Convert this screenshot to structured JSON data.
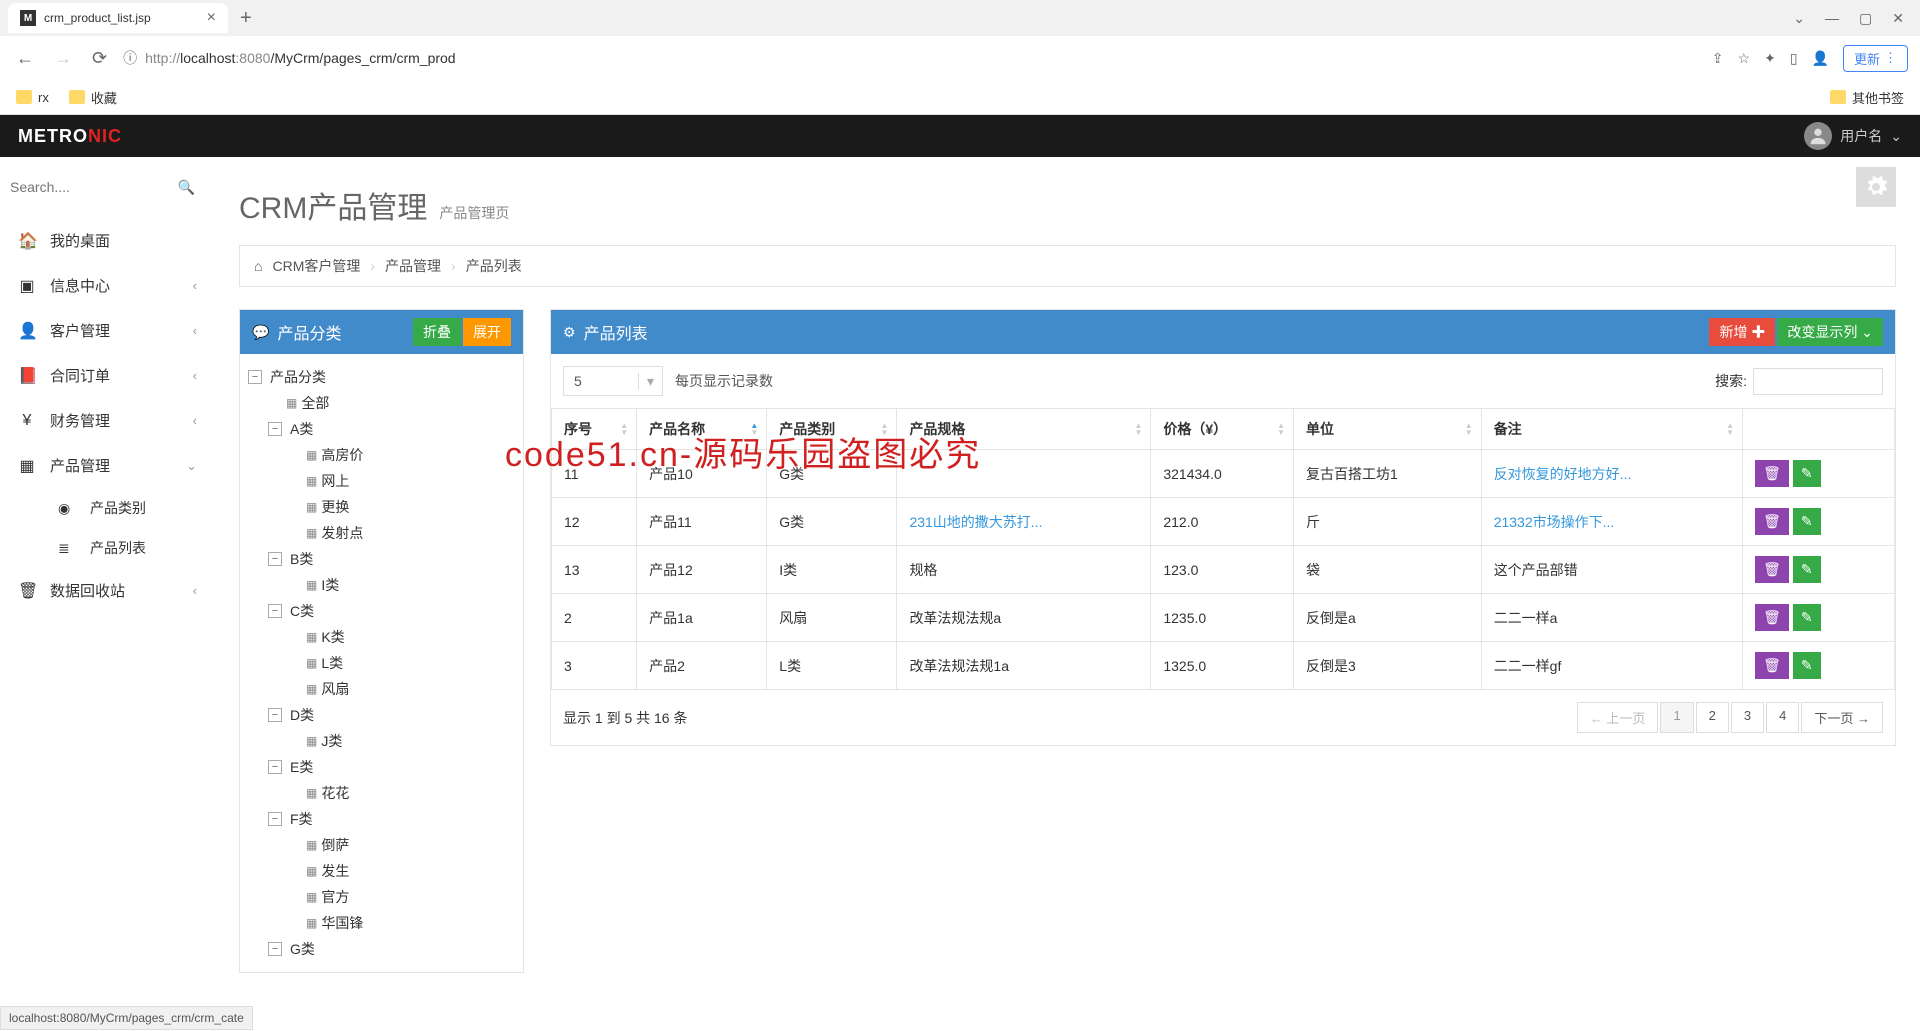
{
  "browser": {
    "tab_title": "crm_product_list.jsp",
    "url_prefix": "http://",
    "url_host": "localhost",
    "url_port": ":8080",
    "url_path": "/MyCrm/pages_crm/crm_prod",
    "update_btn": "更新",
    "bookmarks": [
      "rx",
      "收藏"
    ],
    "other_bookmarks": "其他书签"
  },
  "header": {
    "logo_a": "METRO",
    "logo_b": "NIC",
    "username": "用户名"
  },
  "sidebar": {
    "search_placeholder": "Search....",
    "items": [
      {
        "icon": "🏠",
        "label": "我的桌面"
      },
      {
        "icon": "▣",
        "label": "信息中心",
        "expandable": true
      },
      {
        "icon": "👤",
        "label": "客户管理",
        "expandable": true
      },
      {
        "icon": "📕",
        "label": "合同订单",
        "expandable": true
      },
      {
        "icon": "¥",
        "label": "财务管理",
        "expandable": true
      },
      {
        "icon": "▦",
        "label": "产品管理",
        "expanded": true,
        "children": [
          {
            "icon": "◉",
            "label": "产品类别"
          },
          {
            "icon": "≣",
            "label": "产品列表"
          }
        ]
      },
      {
        "icon": "🗑",
        "label": "数据回收站",
        "expandable": true
      }
    ]
  },
  "page": {
    "title": "CRM产品管理",
    "subtitle": "产品管理页",
    "breadcrumb": [
      "CRM客户管理",
      "产品管理",
      "产品列表"
    ]
  },
  "category_panel": {
    "title": "产品分类",
    "collapse_btn": "折叠",
    "expand_btn": "展开",
    "root": "产品分类",
    "nodes": [
      {
        "label": "全部",
        "leaf": true
      },
      {
        "label": "A类",
        "children": [
          "高房价",
          "网上",
          "更换",
          "发射点"
        ]
      },
      {
        "label": "B类",
        "children": [
          "I类"
        ]
      },
      {
        "label": "C类",
        "children": [
          "K类",
          "L类",
          "风扇"
        ]
      },
      {
        "label": "D类",
        "children": [
          "J类"
        ]
      },
      {
        "label": "E类",
        "children": [
          "花花"
        ]
      },
      {
        "label": "F类",
        "children": [
          "倒萨",
          "发生",
          "官方",
          "华国锋"
        ]
      },
      {
        "label": "G类",
        "children": []
      }
    ]
  },
  "list_panel": {
    "title": "产品列表",
    "add_btn": "新增",
    "columns_btn": "改变显示列",
    "page_size": "5",
    "page_size_label": "每页显示记录数",
    "search_label": "搜索:",
    "headers": [
      "序号",
      "产品名称",
      "产品类别",
      "产品规格",
      "价格（¥）",
      "单位",
      "备注",
      ""
    ],
    "rows": [
      {
        "no": "11",
        "name": "产品10",
        "cat": "G类",
        "spec": "",
        "price": "321434.0",
        "unit": "复古百搭工坊1",
        "note": "反对恢复的好地方好...",
        "note_link": true
      },
      {
        "no": "12",
        "name": "产品11",
        "cat": "G类",
        "spec": "231山地的撒大苏打...",
        "spec_link": true,
        "price": "212.0",
        "unit": "斤",
        "note": "21332市场操作下...",
        "note_link": true
      },
      {
        "no": "13",
        "name": "产品12",
        "cat": "I类",
        "spec": "规格",
        "price": "123.0",
        "unit": "袋",
        "note": "这个产品部错"
      },
      {
        "no": "2",
        "name": "产品1a",
        "cat": "风扇",
        "spec": "改革法规法规a",
        "price": "1235.0",
        "unit": "反倒是a",
        "note": "二二一样a"
      },
      {
        "no": "3",
        "name": "产品2",
        "cat": "L类",
        "spec": "改革法规法规1a",
        "price": "1325.0",
        "unit": "反倒是3",
        "note": "二二一样gf"
      }
    ],
    "footer_info": "显示 1 到 5 共 16 条",
    "prev": "← 上一页",
    "next": "下一页 →",
    "pages": [
      "1",
      "2",
      "3",
      "4"
    ]
  },
  "watermark": "code51.cn-源码乐园盗图必究",
  "status_bar": "localhost:8080/MyCrm/pages_crm/crm_cate"
}
